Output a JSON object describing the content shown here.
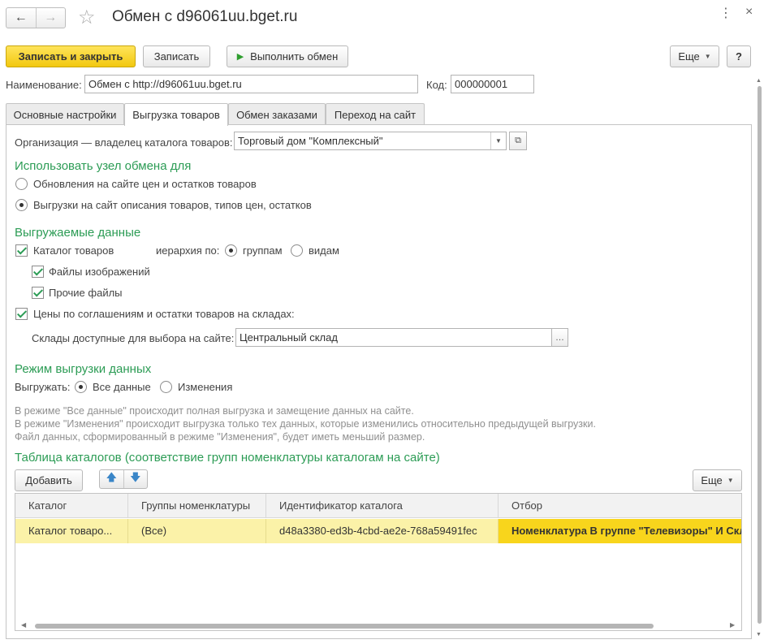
{
  "window": {
    "title": "Обмен с d96061uu.bget.ru",
    "menu_glyph": "⋮",
    "close_glyph": "×"
  },
  "toolbar": {
    "save_close": "Записать и закрыть",
    "save": "Записать",
    "run_exchange": "Выполнить обмен",
    "more": "Еще",
    "help": "?"
  },
  "header": {
    "name_label": "Наименование:",
    "name_value": "Обмен с http://d96061uu.bget.ru",
    "code_label": "Код:",
    "code_value": "000000001"
  },
  "tabs": [
    {
      "label": "Основные настройки"
    },
    {
      "label": "Выгрузка товаров"
    },
    {
      "label": "Обмен заказами"
    },
    {
      "label": "Переход на сайт"
    }
  ],
  "form": {
    "org_label": "Организация — владелец каталога товаров:",
    "org_value": "Торговый дом \"Комплексный\"",
    "use_node_title": "Использовать узел обмена для",
    "use_node_options": [
      {
        "label": "Обновления на сайте цен и остатков товаров",
        "selected": false
      },
      {
        "label": "Выгрузки на сайт описания товаров, типов цен, остатков",
        "selected": true
      }
    ],
    "export_data_title": "Выгружаемые данные",
    "catalog_label": "Каталог товаров",
    "catalog_checked": true,
    "hierarchy_label": "иерархия по:",
    "hierarchy_groups": "группам",
    "hierarchy_kinds": "видам",
    "images_label": "Файлы изображений",
    "images_checked": true,
    "other_files_label": "Прочие файлы",
    "other_files_checked": true,
    "prices_label": "Цены по соглашениям и остатки товаров на складах:",
    "prices_checked": true,
    "warehouses_label": "Склады доступные для выбора на сайте:",
    "warehouses_value": "Центральный склад",
    "mode_title": "Режим выгрузки данных",
    "mode_label": "Выгружать:",
    "mode_all": "Все данные",
    "mode_changes": "Изменения",
    "notes": [
      "В режиме \"Все данные\" происходит полная выгрузка  и замещение данных на сайте.",
      "В режиме \"Изменения\" происходит выгрузка только тех данных, которые изменились относительно предыдущей выгрузки.",
      "Файл данных, сформированный в режиме \"Изменения\", будет иметь меньший размер."
    ],
    "table_title": "Таблица каталогов (соответствие групп номенклатуры каталогам на сайте)",
    "add_button": "Добавить",
    "more_button": "Еще"
  },
  "grid": {
    "columns": [
      "Каталог",
      "Группы номенклатуры",
      "Идентификатор каталога",
      "Отбор"
    ],
    "rows": [
      [
        "Каталог товаро...",
        "(Все)",
        "d48a3380-ed3b-4cbd-ae2e-768a59491fec",
        "Номенклатура В группе \"Телевизоры\" И Склад"
      ]
    ]
  },
  "colors": {
    "accent_green": "#2c9c55",
    "primary_button": "#f2c80f",
    "row_highlight": "#fbf2a8",
    "cell_selected": "#f8d51c"
  }
}
